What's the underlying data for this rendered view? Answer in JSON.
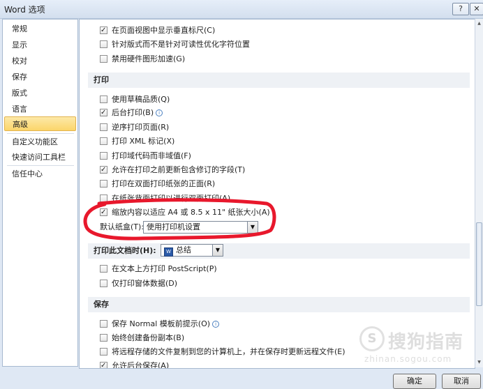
{
  "window": {
    "title": "Word 选项",
    "help_btn": "?",
    "close_btn": "✕"
  },
  "sidebar": {
    "items": [
      {
        "label": "常规"
      },
      {
        "label": "显示"
      },
      {
        "label": "校对"
      },
      {
        "label": "保存"
      },
      {
        "label": "版式"
      },
      {
        "label": "语言"
      },
      {
        "label": "高级"
      },
      {
        "label": "自定义功能区"
      },
      {
        "label": "快速访问工具栏"
      },
      {
        "label": "信任中心"
      }
    ]
  },
  "options_top": [
    {
      "label": "在页面视图中显示垂直标尺(C)",
      "checked": true
    },
    {
      "label": "针对版式而不是针对可读性优化字符位置",
      "checked": false
    },
    {
      "label": "禁用硬件图形加速(G)",
      "checked": false
    }
  ],
  "print_section": {
    "title": "打印",
    "options": [
      {
        "label": "使用草稿品质(Q)",
        "checked": false
      },
      {
        "label": "后台打印(B)",
        "checked": true,
        "info": true
      },
      {
        "label": "逆序打印页面(R)",
        "checked": false
      },
      {
        "label": "打印 XML 标记(X)",
        "checked": false
      },
      {
        "label": "打印域代码而非域值(F)",
        "checked": false
      },
      {
        "label": "允许在打印之前更新包含修订的字段(T)",
        "checked": true
      },
      {
        "label": "打印在双面打印纸张的正面(R)",
        "checked": false
      },
      {
        "label": "在纸张背面打印以进行双面打印(A)",
        "checked": false
      },
      {
        "label": "缩放内容以适应 A4 或 8.5 x 11\" 纸张大小(A)",
        "checked": true
      }
    ],
    "tray_label": "默认纸盒(T):",
    "tray_value": "使用打印机设置"
  },
  "print_doc": {
    "label": "打印此文档时(H):",
    "icon_text": "W",
    "doc_value": "总结",
    "options": [
      {
        "label": "在文本上方打印 PostScript(P)",
        "checked": false
      },
      {
        "label": "仅打印窗体数据(D)",
        "checked": false
      }
    ]
  },
  "save_section": {
    "title": "保存",
    "options": [
      {
        "label": "保存 Normal 模板前提示(O)",
        "checked": false,
        "info": true
      },
      {
        "label": "始终创建备份副本(B)",
        "checked": false
      },
      {
        "label": "将远程存储的文件复制到您的计算机上，并在保存时更新远程文件(E)",
        "checked": false
      },
      {
        "label": "允许后台保存(A)",
        "checked": true
      }
    ]
  },
  "buttons": {
    "ok": "确定",
    "cancel": "取消"
  },
  "watermark": {
    "logo": "S",
    "text": "搜狗指南",
    "url": "zhinan.sogou.com"
  },
  "colors": {
    "annotation": "#e8182c",
    "active_nav": "#fbd56a"
  }
}
